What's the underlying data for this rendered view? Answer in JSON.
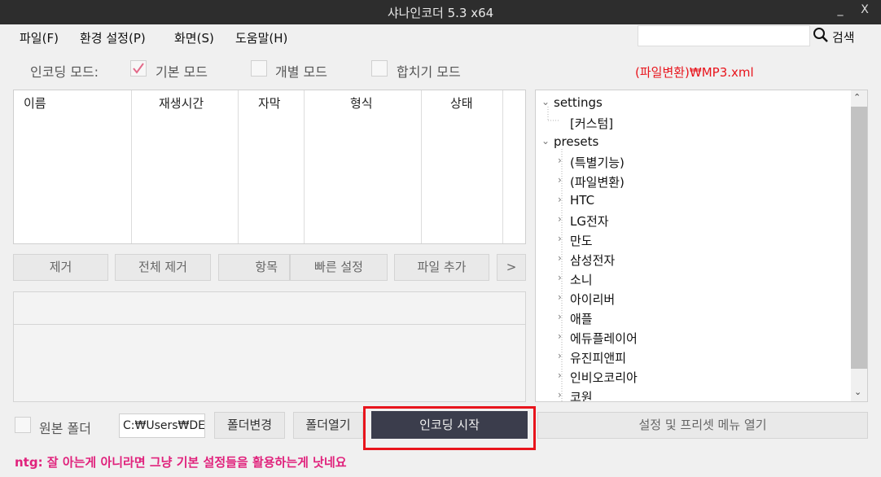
{
  "window": {
    "title": "샤나인코더  5.3  x64",
    "minimize_glyph": "_",
    "close_glyph": "X"
  },
  "menu": [
    "파일(F)",
    "환경 설정(P)",
    "화면(S)",
    "도움말(H)"
  ],
  "search": {
    "button_label": "검색",
    "icon": "magnifier-icon",
    "value": ""
  },
  "mode": {
    "label": "인코딩 모드:",
    "options": [
      {
        "label": "기본 모드",
        "checked": true
      },
      {
        "label": "개별 모드",
        "checked": false
      },
      {
        "label": "합치기 모드",
        "checked": false
      }
    ],
    "current_preset": "(파일변환)₩MP3.xml"
  },
  "file_table": {
    "columns": [
      "이름",
      "재생시간",
      "자막",
      "형식",
      "상태"
    ],
    "rows": []
  },
  "list_buttons": [
    "제거",
    "전체 제거",
    "항목",
    "빠른 설정",
    "파일 추가",
    ">"
  ],
  "tree": {
    "nodes": [
      {
        "label": "settings",
        "level": 0,
        "expanded": true
      },
      {
        "label": "[커스텀]",
        "level": 1,
        "expanded": false
      },
      {
        "label": "presets",
        "level": 0,
        "expanded": true
      },
      {
        "label": "(특별기능)",
        "level": 1,
        "expanded": false
      },
      {
        "label": "(파일변환)",
        "level": 1,
        "expanded": false
      },
      {
        "label": "HTC",
        "level": 1,
        "expanded": false
      },
      {
        "label": "LG전자",
        "level": 1,
        "expanded": false
      },
      {
        "label": "만도",
        "level": 1,
        "expanded": false
      },
      {
        "label": "삼성전자",
        "level": 1,
        "expanded": false
      },
      {
        "label": "소니",
        "level": 1,
        "expanded": false
      },
      {
        "label": "아이리버",
        "level": 1,
        "expanded": false
      },
      {
        "label": "애플",
        "level": 1,
        "expanded": false
      },
      {
        "label": "에듀플레이어",
        "level": 1,
        "expanded": false
      },
      {
        "label": "유진피앤피",
        "level": 1,
        "expanded": false
      },
      {
        "label": "인비오코리아",
        "level": 1,
        "expanded": false
      },
      {
        "label": "코원",
        "level": 1,
        "expanded": false
      }
    ]
  },
  "bottom": {
    "source_folder_label": "원본 폴더",
    "source_folder_checked": false,
    "folder_path": "C:₩Users₩DE",
    "change_folder": "폴더변경",
    "open_folder": "폴더열기",
    "start_encoding": "인코딩 시작",
    "open_menu": "설정 및 프리셋 메뉴 열기"
  },
  "footer_note": "ntg: 잘 아는게 아니라면 그냥 기본 설정들을 활용하는게 낫네요",
  "colors": {
    "titlebar": "#2d2d2d",
    "start_button": "#3b3d4c",
    "highlight": "#e8141c",
    "note": "#e0227c",
    "check": "#e36a8a"
  }
}
